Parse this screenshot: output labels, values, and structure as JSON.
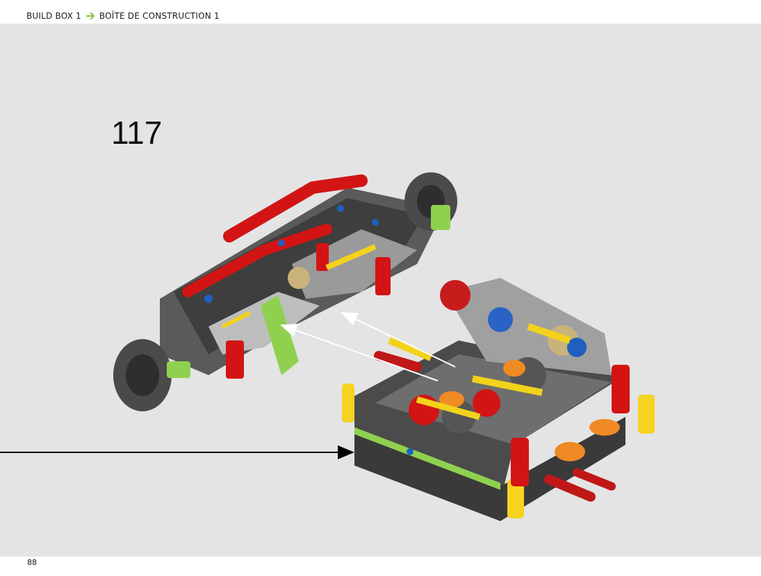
{
  "header": {
    "part_label": "BUILD BOX 1",
    "separator_icon": "chevron-arrow-icon",
    "part_label_fr": "BOÎTE DE CONSTRUCTION 1",
    "accent_color": "#8cc63f"
  },
  "step": {
    "number": "117"
  },
  "footer": {
    "page_number": "88"
  }
}
